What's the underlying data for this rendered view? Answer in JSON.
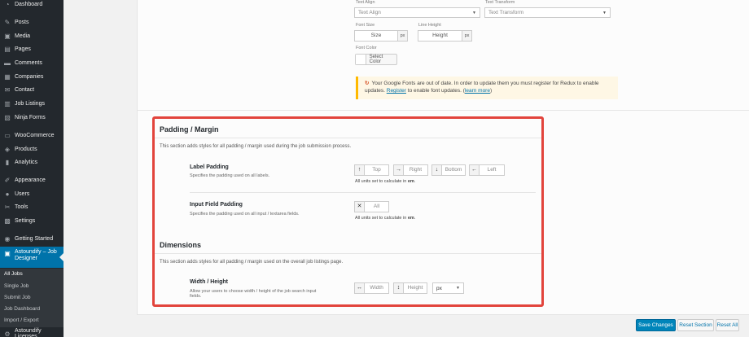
{
  "sidebar": {
    "items": [
      {
        "label": "Dashboard",
        "icon": "dashboard-icon"
      },
      {
        "label": "Posts",
        "icon": "pin-icon"
      },
      {
        "label": "Media",
        "icon": "media-icon"
      },
      {
        "label": "Pages",
        "icon": "page-icon"
      },
      {
        "label": "Comments",
        "icon": "comment-icon"
      },
      {
        "label": "Companies",
        "icon": "companies-icon"
      },
      {
        "label": "Contact",
        "icon": "mail-icon"
      },
      {
        "label": "Job Listings",
        "icon": "briefcase-icon"
      },
      {
        "label": "Ninja Forms",
        "icon": "forms-icon"
      },
      {
        "label": "WooCommerce",
        "icon": "woo-icon"
      },
      {
        "label": "Products",
        "icon": "products-icon"
      },
      {
        "label": "Analytics",
        "icon": "analytics-icon"
      },
      {
        "label": "Appearance",
        "icon": "brush-icon"
      },
      {
        "label": "Users",
        "icon": "users-icon"
      },
      {
        "label": "Tools",
        "icon": "wrench-icon"
      },
      {
        "label": "Settings",
        "icon": "settings-icon"
      },
      {
        "label": "Getting Started",
        "icon": "play-icon"
      },
      {
        "label": "Astoundify – Job Designer",
        "icon": "designer-icon"
      },
      {
        "label": "Astoundify Licenses",
        "icon": "key-icon"
      }
    ],
    "submenu": [
      "All Jobs",
      "Single Job",
      "Submit Job",
      "Job Dashboard",
      "Import / Export"
    ]
  },
  "typography": {
    "text_align_label": "Text Align",
    "text_align_value": "Text Align",
    "text_transform_label": "Text Transform",
    "text_transform_value": "Text Transform",
    "font_size_label": "Font Size",
    "font_size_value": "Size",
    "line_height_label": "Line Height",
    "line_height_value": "Height",
    "unit": "px",
    "font_color_label": "Font Color",
    "select_color": "Select Color"
  },
  "notice": {
    "text_before": "Your Google Fonts are out of date. In order to update them you must register for Redux to enable updates.",
    "register_link": "Register",
    "text_middle": "to enable font updates. (",
    "learn_more": "learn more",
    "text_after": ")"
  },
  "padding_section": {
    "title": "Padding / Margin",
    "description": "This section adds styles for all padding / margin used during the job submission process.",
    "label_padding": {
      "title": "Label Padding",
      "description": "Specifies the padding used on all labels.",
      "top": "Top",
      "right": "Right",
      "bottom": "Bottom",
      "left": "Left",
      "note_prefix": "All units set to calculate in ",
      "note_unit": "em",
      "note_suffix": "."
    },
    "input_padding": {
      "title": "Input Field Padding",
      "description": "Specifies the padding used on all input / textarea fields.",
      "all": "All",
      "note_prefix": "All units set to calculate in ",
      "note_unit": "em",
      "note_suffix": "."
    }
  },
  "dimensions_section": {
    "title": "Dimensions",
    "description": "This section adds styles for all padding / margin used on the overall job listings page.",
    "width_height": {
      "title": "Width / Height",
      "description_line1": "Allow your users to choose width / height of the job search input",
      "description_line2": "fields.",
      "width": "Width",
      "height": "Height",
      "unit": "px"
    }
  },
  "footer": {
    "save": "Save Changes",
    "reset_section": "Reset Section",
    "reset_all": "Reset All"
  },
  "colors": {
    "sidebar_bg": "#23282d",
    "accent": "#0073aa",
    "highlight_border": "#e2443c",
    "notice_border": "#ffb900"
  }
}
